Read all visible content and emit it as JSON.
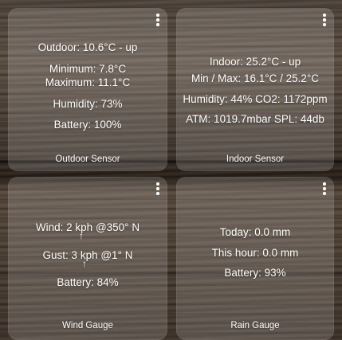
{
  "outdoor": {
    "caption": "Outdoor Sensor",
    "temperature": "Outdoor: 10.6°C - up",
    "minimum": "Minimum: 7.8°C",
    "maximum": "Maximum: 11.1°C",
    "humidity": "Humidity: 73%",
    "battery": "Battery: 100%",
    "menu_icon": "more-vert-icon"
  },
  "indoor": {
    "caption": "Indoor Sensor",
    "temperature": "Indoor: 25.2°C - up",
    "minmax": "Min / Max: 16.1°C / 25.2°C",
    "humidity_co2": "Humidity: 44%  CO2: 1172ppm",
    "pressure_noise": "ATM: 1019.7mbar  SPL: 44db",
    "menu_icon": "more-vert-icon"
  },
  "wind": {
    "caption": "Wind Gauge",
    "wind": "Wind: 2 kph @350° N",
    "gust": "Gust: 3 kph @1° N",
    "battery": "Battery: 84%",
    "direction_arrow": "↑",
    "menu_icon": "more-vert-icon"
  },
  "rain": {
    "caption": "Rain Gauge",
    "today": "Today: 0.0 mm",
    "this_hour": "This hour: 0.0 mm",
    "battery": "Battery: 93%",
    "menu_icon": "more-vert-icon"
  }
}
